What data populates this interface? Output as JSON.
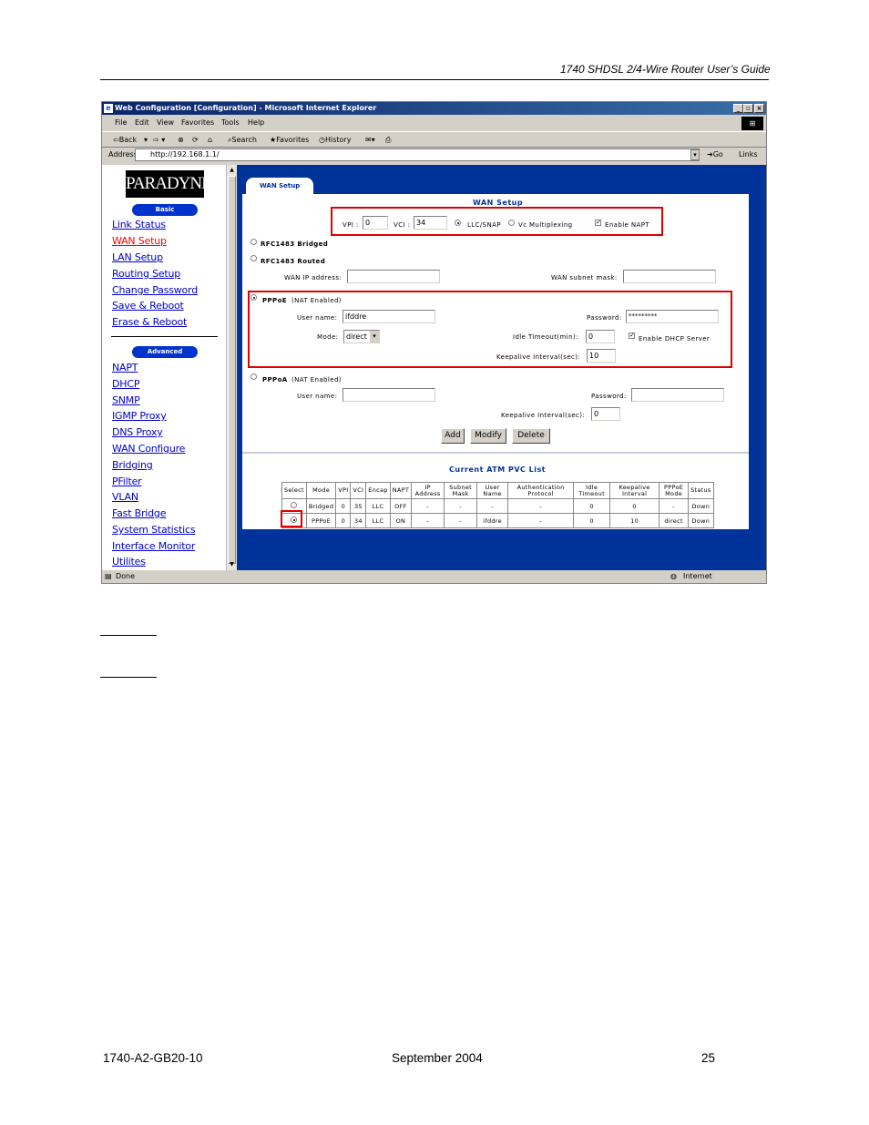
{
  "doc": {
    "header": "1740 SHDSL 2/4-Wire Router User’s Guide",
    "footer_left": "1740-A2-GB20-10",
    "footer_center": "September 2004",
    "footer_right": "25"
  },
  "browser": {
    "title": "Web Configuration [Configuration] - Microsoft Internet Explorer",
    "menu": [
      "File",
      "Edit",
      "View",
      "Favorites",
      "Tools",
      "Help"
    ],
    "toolbar": {
      "back": "⇦Back",
      "search": "Search",
      "favorites": "Favorites",
      "history": "History"
    },
    "address_label": "Address",
    "address": "http://192.168.1.1/",
    "go": "Go",
    "links": "Links",
    "status_left": "Done",
    "status_right": "Internet"
  },
  "nav": {
    "logo": "PARADYNE",
    "basic_label": "Basic",
    "advanced_label": "Advanced",
    "basic_items": [
      "Link Status",
      "WAN Setup",
      "LAN Setup",
      "Routing Setup",
      "Change Password",
      "Save & Reboot",
      "Erase & Reboot"
    ],
    "advanced_items": [
      "NAPT",
      "DHCP",
      "SNMP",
      "IGMP Proxy",
      "DNS Proxy",
      "WAN Configure",
      "Bridging",
      "PFilter",
      "VLAN",
      "Fast Bridge",
      "System Statistics",
      "Interface Monitor",
      "Utilites"
    ]
  },
  "wan": {
    "tab_label": "WAN Setup",
    "title": "WAN Setup",
    "vpi_label": "VPI :",
    "vpi_value": "0",
    "vci_label": "VCI :",
    "vci_value": "34",
    "llc_label": "LLC/SNAP",
    "vc_label": "Vc Multiplexing",
    "napt_label": "Enable NAPT",
    "rfc_bridged": "RFC1483 Bridged",
    "rfc_routed": "RFC1483 Routed",
    "wan_ip_label": "WAN IP address:",
    "wan_mask_label": "WAN subnet mask:",
    "pppoe_label": "PPPoE",
    "pppoa_label": "PPPoA",
    "nat_note": "(NAT Enabled)",
    "username_label": "User name:",
    "pppoe_username": "ifddre",
    "password_label": "Password:",
    "pppoe_password": "*********",
    "mode_label": "Mode:",
    "mode_value": "direct",
    "idle_label": "Idle Timeout(min):",
    "idle_value": "0",
    "dhcp_label": "Enable DHCP Server",
    "keepalive_label": "Keepalive Interval(sec):",
    "keepalive_value": "10",
    "pppoa_keepalive_value": "0",
    "add": "Add",
    "modify": "Modify",
    "delete": "Delete",
    "list_title": "Current ATM PVC List",
    "columns": [
      "Select",
      "Mode",
      "VPI",
      "VCI",
      "Encap",
      "NAPT",
      "IP Address",
      "Subnet Mask",
      "User Name",
      "Authentication Protocol",
      "Idle Timeout",
      "Keepalive Interval",
      "PPPoE Mode",
      "Status"
    ],
    "rows": [
      [
        "",
        "Bridged",
        "0",
        "35",
        "LLC",
        "OFF",
        "-",
        "-",
        "-",
        "-",
        "0",
        "0",
        "-",
        "Down"
      ],
      [
        "",
        "PPPoE",
        "0",
        "34",
        "LLC",
        "ON",
        "-",
        "-",
        "ifddre",
        "-",
        "0",
        "10",
        "direct",
        "Down"
      ]
    ]
  }
}
